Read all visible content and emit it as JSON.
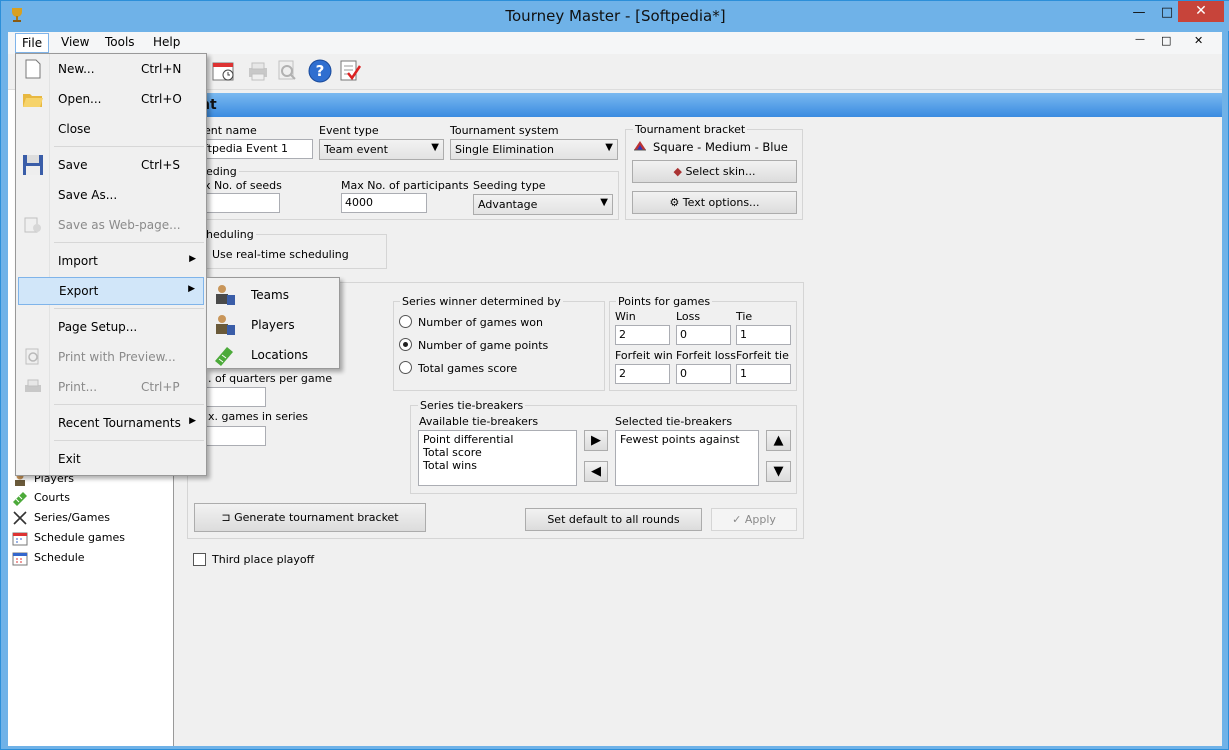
{
  "window": {
    "title": "Tourney Master - [Softpedia*]",
    "minimize": "—",
    "maximize": "□",
    "close": "✕"
  },
  "inner_controls": {
    "minimize": "—",
    "restore": "□",
    "close": "✕"
  },
  "menubar": {
    "file": "File",
    "view": "View",
    "tools": "Tools",
    "help": "Help"
  },
  "header": {
    "title": "nt"
  },
  "event": {
    "name_label": "ent name",
    "name_value": "ftpedia Event 1",
    "type_label": "Event type",
    "type_value": "Team event",
    "system_label": "Tournament system",
    "system_value": "Single Elimination"
  },
  "bracket": {
    "label": "Tournament bracket",
    "skin_value": "Square - Medium - Blue",
    "select_skin": "Select skin...",
    "text_options": "Text options..."
  },
  "seeding": {
    "label": "eding",
    "max_seeds_label": "x No. of seeds",
    "max_participants_label": "Max No. of participants",
    "max_participants_value": "4000",
    "type_label": "Seeding type",
    "type_value": "Advantage"
  },
  "scheduling": {
    "label": "heduling",
    "realtime_label": "Use real-time scheduling"
  },
  "series": {
    "quarters_label": ". of quarters per game",
    "max_games_label": "x. games in series",
    "winner_label": "Series winner determined by",
    "options": [
      "Number of games won",
      "Number of game points",
      "Total games score"
    ],
    "selected": "Number of game points"
  },
  "points": {
    "label": "Points for games",
    "win_label": "Win",
    "win": "2",
    "loss_label": "Loss",
    "loss": "0",
    "tie_label": "Tie",
    "tie": "1",
    "fwin_label": "Forfeit win",
    "fwin": "2",
    "floss_label": "Forfeit loss",
    "floss": "0",
    "ftie_label": "Forfeit tie",
    "ftie": "1"
  },
  "tiebreakers": {
    "label": "Series tie-breakers",
    "available_label": "Available tie-breakers",
    "available": [
      "Point differential",
      "Total score",
      "Total wins"
    ],
    "selected_label": "Selected tie-breakers",
    "selected": [
      "Fewest points against"
    ]
  },
  "buttons": {
    "generate": "Generate tournament bracket",
    "set_default": "Set default to all rounds",
    "apply": "Apply"
  },
  "third_place": "Third place playoff",
  "sidebar": {
    "items": [
      "Players",
      "Courts",
      "Series/Games",
      "Schedule games",
      "Schedule"
    ]
  },
  "file_menu": {
    "new": "New...",
    "new_key": "Ctrl+N",
    "open": "Open...",
    "open_key": "Ctrl+O",
    "close": "Close",
    "save": "Save",
    "save_key": "Ctrl+S",
    "save_as": "Save As...",
    "save_web": "Save as Web-page...",
    "import": "Import",
    "export": "Export",
    "page_setup": "Page Setup...",
    "print_preview": "Print with Preview...",
    "print": "Print...",
    "print_key": "Ctrl+P",
    "recent": "Recent Tournaments",
    "exit": "Exit"
  },
  "export_menu": {
    "teams": "Teams",
    "players": "Players",
    "locations": "Locations"
  },
  "colors": {
    "title_bar": "#6fb2e8",
    "header": "#3a8be0",
    "menu_highlight": "#d1e6f9",
    "close_button": "#c7443a"
  }
}
